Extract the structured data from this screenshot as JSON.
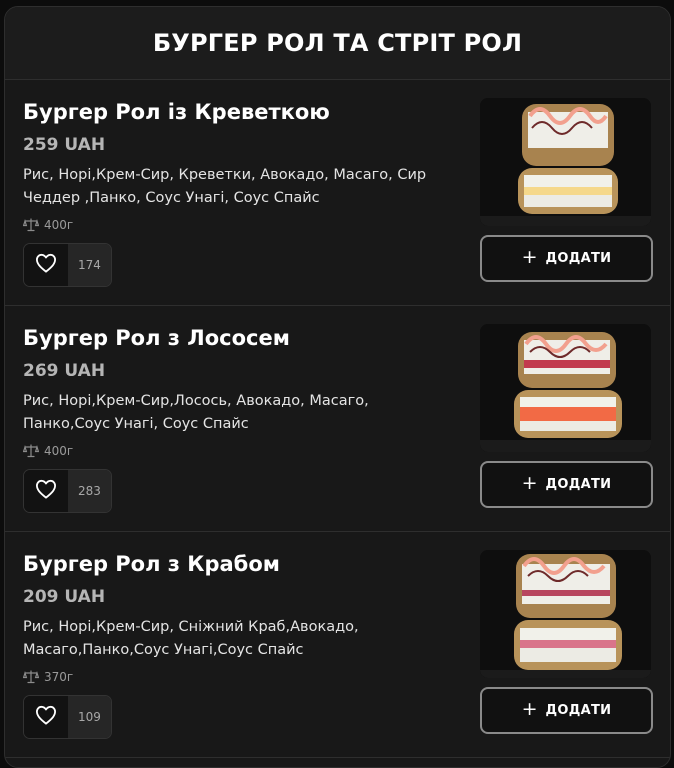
{
  "section": {
    "title": "БУРГЕР РОЛ ТА СТРІТ РОЛ"
  },
  "items": [
    {
      "name": "Бургер Рол із Креветкою",
      "price": "259 UAH",
      "description": "Рис, Норі,Крем-Сир, Креветки, Авокадо, Масаго, Сир Чеддер ,Панко, Соус Унагі, Соус Спайс",
      "weight": "400г",
      "likes": "174",
      "add_label": "ДОДАТИ",
      "add_icon": "+",
      "photo_filling": "#f5d88a"
    },
    {
      "name": "Бургер Рол з Лососем",
      "price": "269 UAH",
      "description": "Рис, Норі,Крем-Сир,Лосось, Авокадо, Масаго, Панко,Соус Унагі, Соус Спайс",
      "weight": "400г",
      "likes": "283",
      "add_label": "ДОДАТИ",
      "add_icon": "+",
      "photo_filling": "#f26a45"
    },
    {
      "name": "Бургер Рол з Крабом",
      "price": "209 UAH",
      "description": "Рис, Норі,Крем-Сир, Сніжний Краб,Авокадо, Масаго,Панко,Соус Унагі,Соус Спайс",
      "weight": "370г",
      "likes": "109",
      "add_label": "ДОДАТИ",
      "add_icon": "+",
      "photo_filling": "#d9748a"
    }
  ],
  "icons": {
    "weight": "scale-icon",
    "like": "heart-icon",
    "add": "plus-icon"
  },
  "colors": {
    "background": "#0c0c0c",
    "panel": "#181818",
    "price": "#b5b5b5",
    "button_border": "#8a8a8a"
  }
}
